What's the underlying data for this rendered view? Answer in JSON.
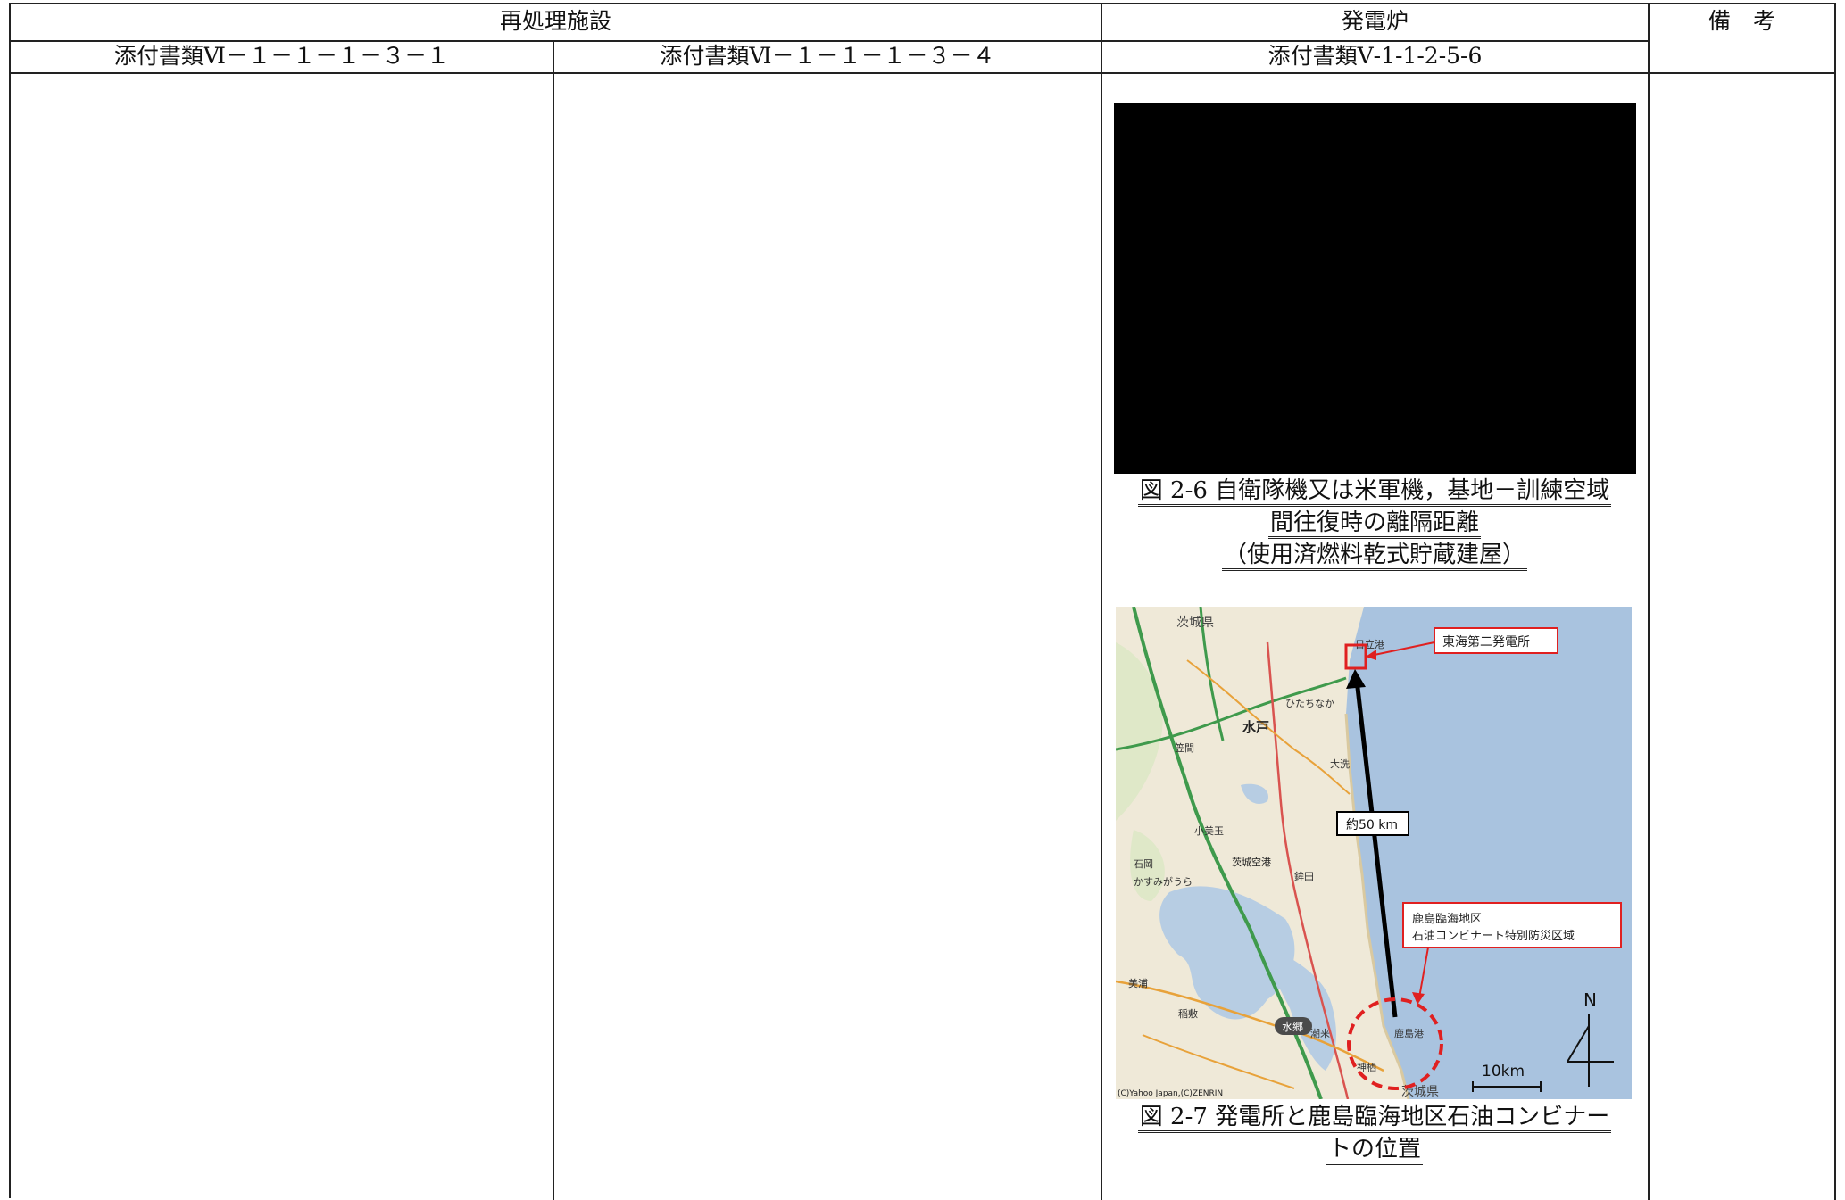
{
  "header": {
    "reprocessing": "再処理施設",
    "reactor": "発電炉",
    "remarks": "備　考",
    "col1": "添付書類Ⅵ－１－１－１－３－１",
    "col2": "添付書類Ⅵ－１－１－１－３－４",
    "col3": "添付書類Ⅴ-1-1-2-5-6"
  },
  "figure_2_6": {
    "caption_line1": "図 2-6 自衛隊機又は米軍機，基地－訓練空域",
    "caption_line2": "間往復時の離隔距離",
    "caption_line3": "（使用済燃料乾式貯蔵建屋）"
  },
  "figure_2_7": {
    "caption_line1": "図 2-7 発電所と鹿島臨海地区石油コンビナー",
    "caption_line2": "トの位置",
    "map": {
      "plant_label": "東海第二発電所",
      "distance_label": "約50 km",
      "kashima_line1": "鹿島臨海地区",
      "kashima_line2": "石油コンビナート特別防災区域",
      "north": "N",
      "scale": "10km",
      "copyright": "(C)Yahoo Japan,(C)ZENRIN",
      "places": {
        "ibaraki_top": "茨城県",
        "hitachi_port": "日立港",
        "mito": "水戸",
        "hitachinaka": "ひたちなか",
        "kasama": "笠間",
        "ibaraki_airport": "茨城空港",
        "kasumigaura": "かすみがうら",
        "suigo": "水郷",
        "kashima_port": "鹿島港",
        "ibaraki_bottom": "茨城県",
        "oarai": "大洗",
        "ishioka": "石岡",
        "hokota": "鉾田",
        "omitama": "小美玉",
        "inashiki": "稲敷",
        "kamisu": "神栖",
        "itako": "潮来",
        "miho": "美浦"
      }
    }
  }
}
